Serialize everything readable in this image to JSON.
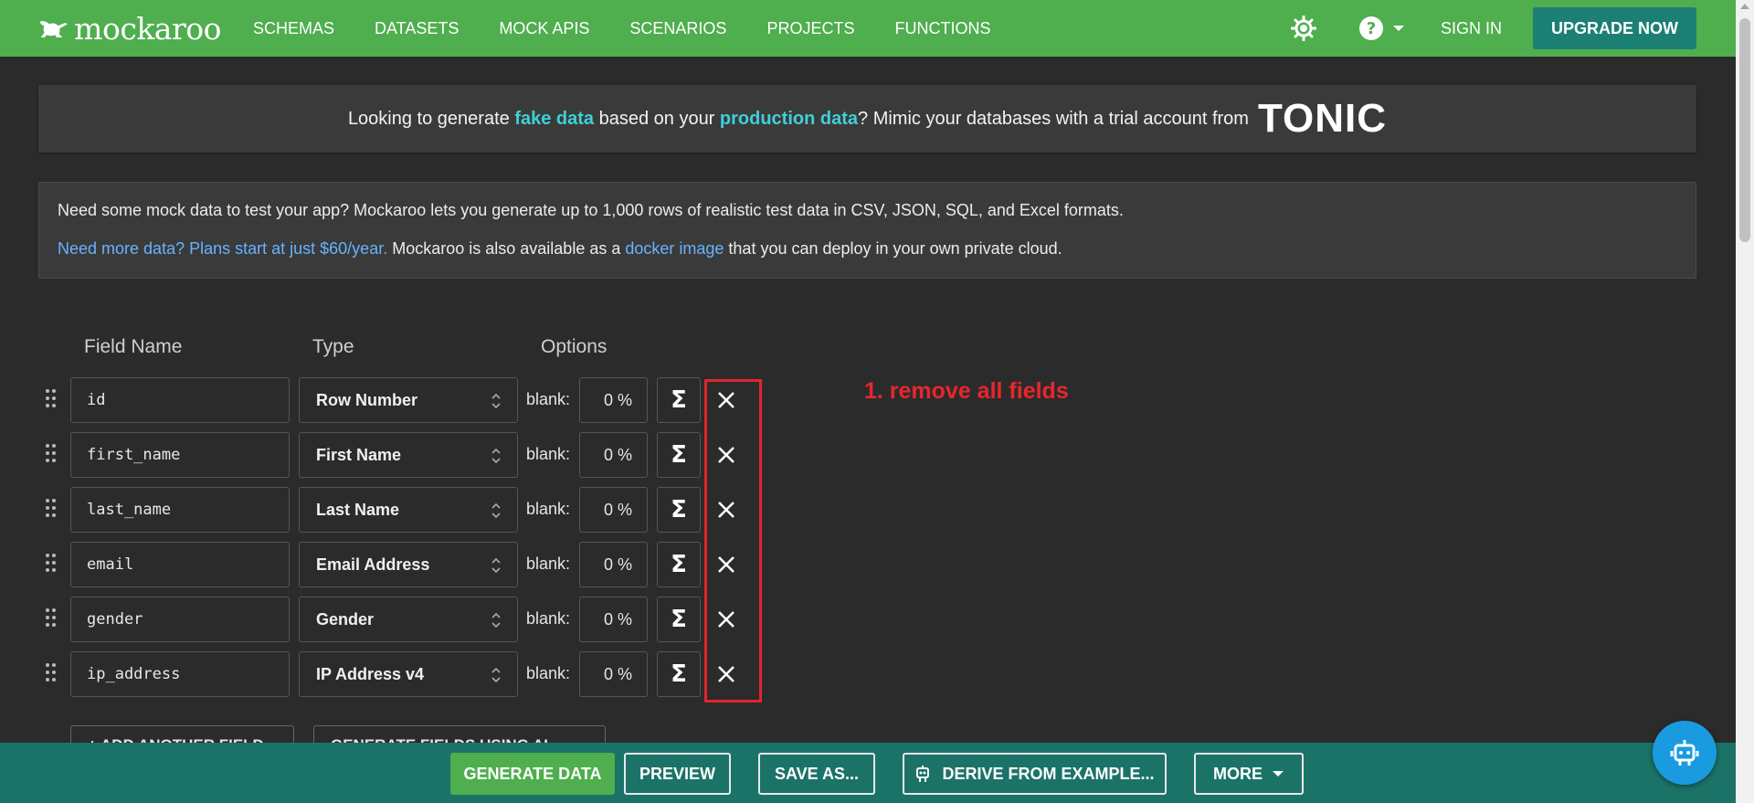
{
  "nav": {
    "logo": "mockaroo",
    "links": [
      "SCHEMAS",
      "DATASETS",
      "MOCK APIS",
      "SCENARIOS",
      "PROJECTS",
      "FUNCTIONS"
    ],
    "sign_in": "SIGN IN",
    "upgrade": "UPGRADE NOW"
  },
  "tonic_banner": {
    "t1": "Looking to generate ",
    "hl1": "fake data",
    "t2": " based on your ",
    "hl2": "production data",
    "t3": "? Mimic your databases with a trial account from",
    "logo": "TONIC"
  },
  "info": {
    "line1": "Need some mock data to test your app? Mockaroo lets you generate up to 1,000 rows of realistic test data in CSV, JSON, SQL, and Excel formats.",
    "plans_link": "Need more data? Plans start at just $60/year.",
    "t2": " Mockaroo is also available as a ",
    "docker_link": "docker image",
    "t3": " that you can deploy in your own private cloud."
  },
  "columns": {
    "field_name": "Field Name",
    "type": "Type",
    "options": "Options"
  },
  "blank_label": "blank:",
  "sigma": "Σ",
  "fields": [
    {
      "name": "id",
      "type": "Row Number",
      "blank": "0 %"
    },
    {
      "name": "first_name",
      "type": "First Name",
      "blank": "0 %"
    },
    {
      "name": "last_name",
      "type": "Last Name",
      "blank": "0 %"
    },
    {
      "name": "email",
      "type": "Email Address",
      "blank": "0 %"
    },
    {
      "name": "gender",
      "type": "Gender",
      "blank": "0 %"
    },
    {
      "name": "ip_address",
      "type": "IP Address v4",
      "blank": "0 %"
    }
  ],
  "annotation": "1. remove all fields",
  "partial_buttons": {
    "add_field": "+  ADD ANOTHER FIELD",
    "gen_ai": "GENERATE FIELDS USING AI..."
  },
  "bottom": {
    "generate": "GENERATE DATA",
    "preview": "PREVIEW",
    "save_as": "SAVE AS...",
    "derive": "DERIVE FROM EXAMPLE...",
    "more": "MORE"
  }
}
